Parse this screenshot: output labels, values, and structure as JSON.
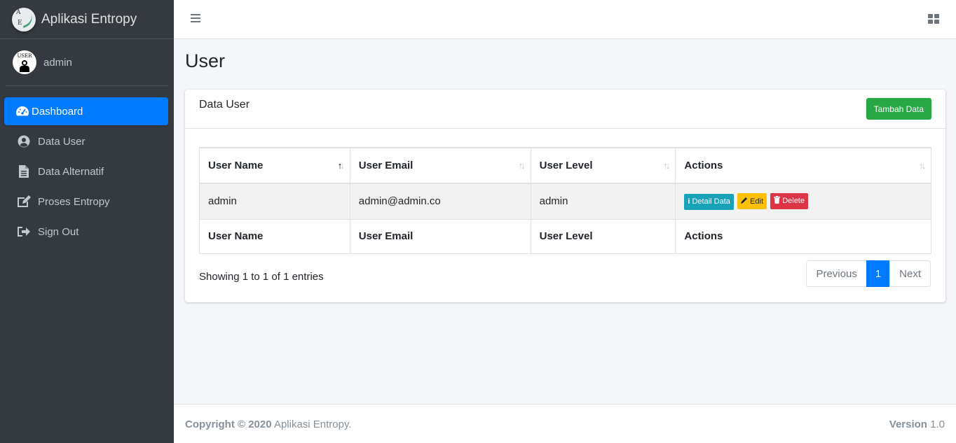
{
  "brand": {
    "name": "Aplikasi Entropy",
    "logo_letters": [
      "A",
      "E"
    ]
  },
  "user_panel": {
    "avatar_text": "USER",
    "name": "admin"
  },
  "sidebar": {
    "items": [
      {
        "label": "Dashboard",
        "icon": "tachometer-icon",
        "active": true
      },
      {
        "label": "Data User",
        "icon": "user-circle-icon"
      },
      {
        "label": "Data Alternatif",
        "icon": "file-icon"
      },
      {
        "label": "Proses Entropy",
        "icon": "edit-icon"
      },
      {
        "label": "Sign Out",
        "icon": "sign-out-icon"
      }
    ]
  },
  "page": {
    "title": "User"
  },
  "card": {
    "title": "Data User",
    "add_button": "Tambah Data"
  },
  "table": {
    "columns": [
      "User Name",
      "User Email",
      "User Level",
      "Actions"
    ],
    "rows": [
      {
        "username": "admin",
        "email": "admin@admin.co",
        "level": "admin"
      }
    ],
    "actions": {
      "detail": "Detail Data",
      "edit": "Edit",
      "delete": "Delete"
    }
  },
  "pagination": {
    "info": "Showing 1 to 1 of 1 entries",
    "previous": "Previous",
    "current": "1",
    "next": "Next"
  },
  "footer": {
    "copyright_bold": "Copyright © 2020",
    "copyright_rest": "Aplikasi Entropy.",
    "version_label": "Version",
    "version_value": "1.0"
  },
  "colors": {
    "sidebar_bg": "#343a40",
    "primary": "#007bff",
    "success": "#28a745",
    "info": "#17a2b8",
    "warning": "#ffc107",
    "danger": "#dc3545"
  }
}
